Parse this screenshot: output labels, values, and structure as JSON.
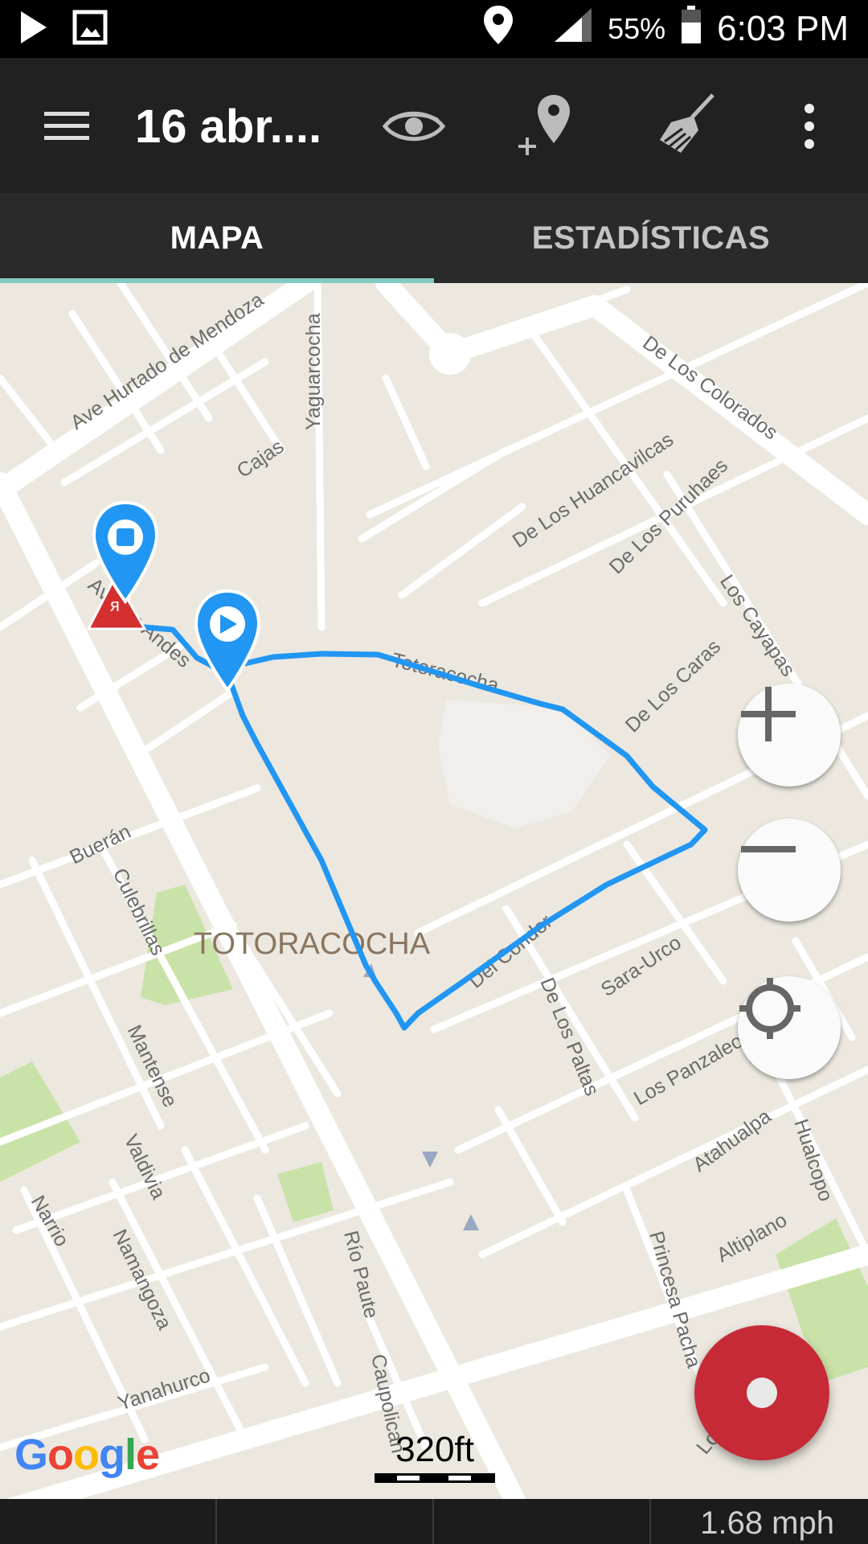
{
  "status_bar": {
    "battery": "55%",
    "time": "6:03 PM",
    "icons": [
      "play-icon",
      "image-icon",
      "location-icon",
      "signal-icon",
      "battery-icon"
    ]
  },
  "app_bar": {
    "title": "16 abr....",
    "icons": [
      "menu-icon",
      "eye-icon",
      "add-location-icon",
      "broom-icon",
      "more-vert-icon"
    ]
  },
  "tabs": [
    {
      "label": "MAPA",
      "active": true
    },
    {
      "label": "ESTADÍSTICAS",
      "active": false
    }
  ],
  "map": {
    "neighborhood": "TOTORACOCHA",
    "streets": [
      "Ave Hurtado de Mendoza",
      "Yaguarcocha",
      "Cajas",
      "De Los Colorados",
      "De Los Huancavilcas",
      "De Los Puruhaes",
      "Los Cayapas",
      "De Los Caras",
      "Av. Los Andes",
      "Totoracocha",
      "Buerán",
      "Culebrillas",
      "Mantense",
      "Del Condor",
      "Sara-Urco",
      "De Los Paltas",
      "Los Panzaleos",
      "Valdivia",
      "Narrio",
      "Namangoza",
      "Atahualpa",
      "Hualcopo",
      "Altiplano",
      "Río Paute",
      "Princesa Pacha",
      "Yanahurco",
      "Caupolican",
      "Lo"
    ],
    "markers": [
      "stop-marker",
      "start-marker",
      "warning-marker"
    ],
    "scale_label": "320ft",
    "attribution": "Google"
  },
  "controls": {
    "zoom_in": "+",
    "zoom_out": "−",
    "locate": "my-location"
  },
  "bottom_bar": {
    "speed": "1.68 mph"
  },
  "colors": {
    "route": "#2196f3",
    "fab": "#c62a37",
    "tab_indicator": "#80cbc4"
  }
}
